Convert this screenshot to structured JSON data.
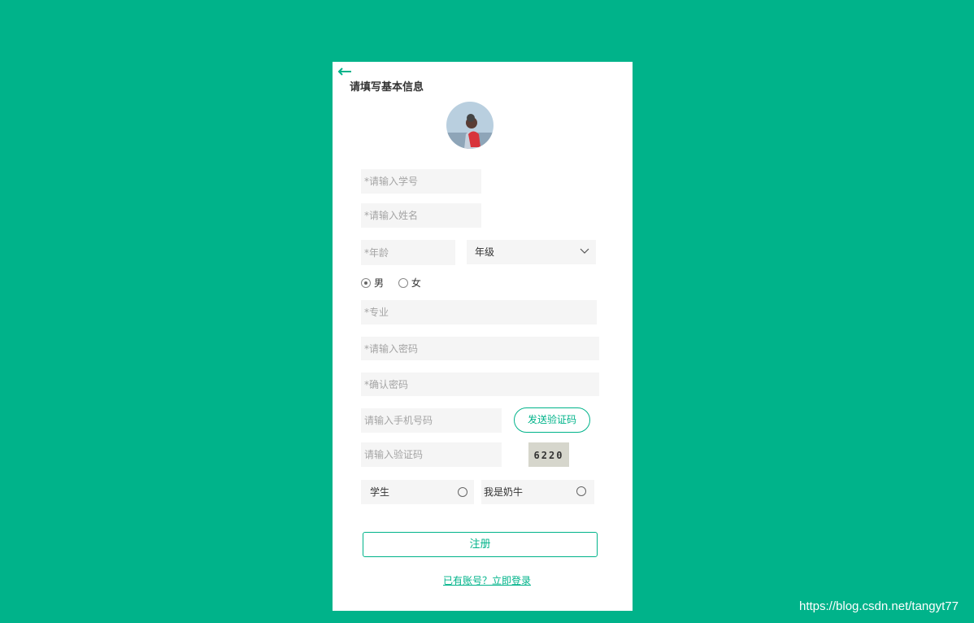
{
  "colors": {
    "background": "#00b38a",
    "card": "#ffffff",
    "accent": "#00b38a",
    "field": "#f5f5f5"
  },
  "header": {
    "back_icon": "arrow-left-icon",
    "title": "请填写基本信息"
  },
  "form": {
    "student_id_placeholder": "*请输入学号",
    "name_placeholder": "*请输入姓名",
    "age_placeholder": "*年龄",
    "grade_select": {
      "selected": "年级",
      "icon": "chevron-down-icon"
    },
    "gender": {
      "male": "男",
      "female": "女",
      "selected": "男"
    },
    "major_placeholder": "*专业",
    "password_placeholder": "*请输入密码",
    "confirm_password_placeholder": "*确认密码",
    "phone_placeholder": "请输入手机号码",
    "send_code_label": "发送验证码",
    "code_placeholder": "请输入验证码",
    "captcha_text": "6220",
    "roles": [
      {
        "label": "学生"
      },
      {
        "label": "我是奶牛"
      }
    ],
    "register_label": "注册",
    "login_link": "已有账号？立即登录"
  },
  "watermark": "https://blog.csdn.net/tangyt77"
}
